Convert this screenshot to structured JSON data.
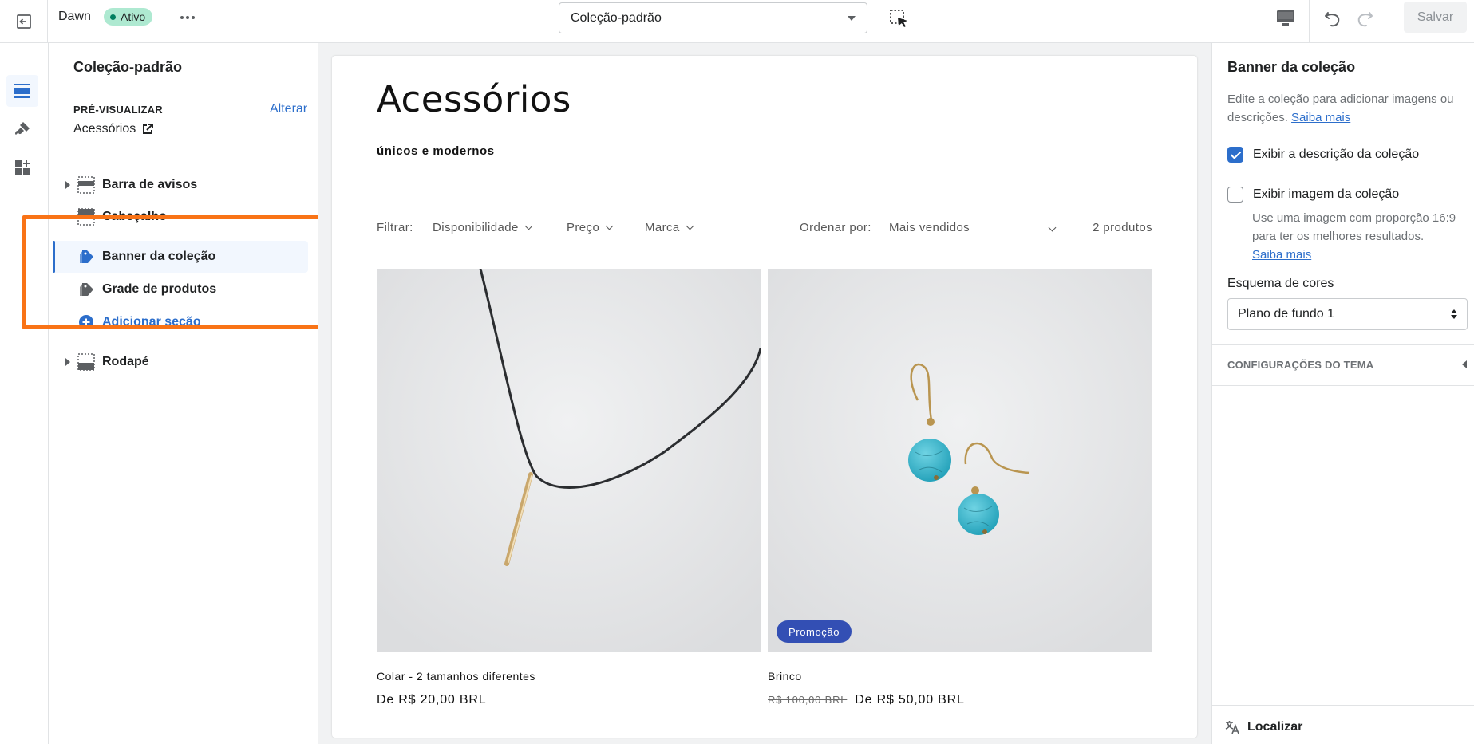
{
  "topbar": {
    "theme_name": "Dawn",
    "status_badge": "Ativo",
    "template_selected": "Coleção-padrão",
    "save_label": "Salvar"
  },
  "left_panel": {
    "title": "Coleção-padrão",
    "preview_label": "PRÉ-VISUALIZAR",
    "change_link": "Alterar",
    "preview_value": "Acessórios",
    "sections": [
      {
        "label": "Barra de avisos",
        "icon": "header-group-icon"
      },
      {
        "label": "Cabeçalho",
        "icon": "header-section-icon"
      },
      {
        "label": "Banner da coleção",
        "icon": "collection-tag-icon"
      },
      {
        "label": "Grade de produtos",
        "icon": "collection-tag-icon"
      },
      {
        "label": "Adicionar seção",
        "icon": "plus-circle-icon"
      },
      {
        "label": "Rodapé",
        "icon": "footer-group-icon"
      }
    ]
  },
  "preview": {
    "collection_title": "Acessórios",
    "collection_description": "únicos e modernos",
    "filter_label": "Filtrar:",
    "filters": [
      "Disponibilidade",
      "Preço",
      "Marca"
    ],
    "sort_label": "Ordenar por:",
    "sort_value": "Mais vendidos",
    "product_count": "2 produtos",
    "products": [
      {
        "title": "Colar - 2 tamanhos diferentes",
        "price": "De R$ 20,00 BRL",
        "old_price": "",
        "badge": ""
      },
      {
        "title": "Brinco",
        "price": "De R$ 50,00 BRL",
        "old_price": "R$ 100,00 BRL",
        "badge": "Promoção"
      }
    ]
  },
  "right_panel": {
    "title": "Banner da coleção",
    "info_text": "Edite a coleção para adicionar imagens ou descrições.",
    "info_link": "Saiba mais",
    "checkbox_description": {
      "label": "Exibir a descrição da coleção",
      "checked": true
    },
    "checkbox_image": {
      "label": "Exibir imagem da coleção",
      "checked": false
    },
    "image_help": "Use uma imagem com proporção 16:9 para ter os melhores resultados.",
    "image_help_link": "Saiba mais",
    "color_scheme_label": "Esquema de cores",
    "color_scheme_value": "Plano de fundo 1",
    "theme_settings": "CONFIGURAÇÕES DO TEMA",
    "localize": "Localizar"
  },
  "colors": {
    "accent": "#2c6ecb",
    "highlight": "#f97316",
    "sale_badge": "#334fb4",
    "active_badge": "#aee9d1"
  }
}
